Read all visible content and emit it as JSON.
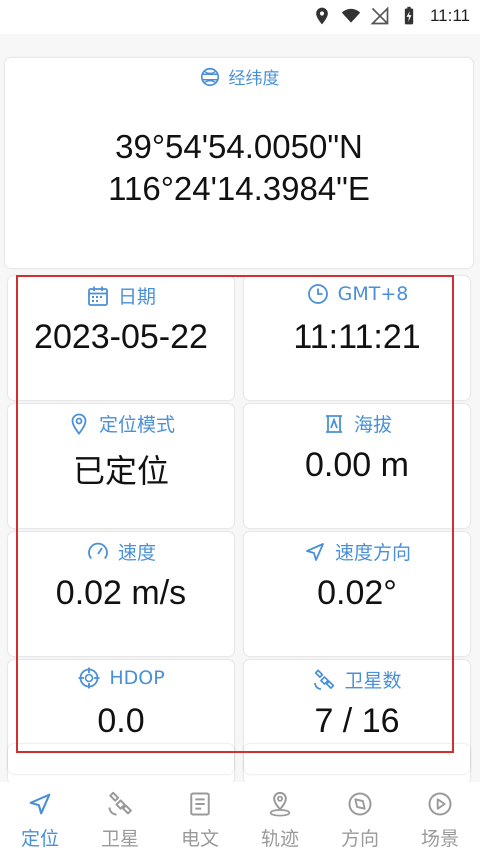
{
  "status_bar": {
    "time": "11:11",
    "icons": [
      "location-pin-icon",
      "wifi-icon",
      "no-signal-icon",
      "battery-charging-icon"
    ]
  },
  "coordinates": {
    "title": "经纬度",
    "latitude": "39°54'54.0050\"N",
    "longitude": "116°24'14.3984\"E"
  },
  "grid": {
    "date": {
      "label": "日期",
      "value": "2023-05-22",
      "icon": "calendar-icon"
    },
    "time": {
      "label": "GMT+8",
      "value": "11:11:21",
      "icon": "clock-icon"
    },
    "mode": {
      "label": "定位模式",
      "value": "已定位",
      "icon": "location-pin-icon"
    },
    "altitude": {
      "label": "海拔",
      "value": "0.00 m",
      "icon": "altitude-icon"
    },
    "speed": {
      "label": "速度",
      "value": "0.02 m/s",
      "icon": "speedometer-icon"
    },
    "heading": {
      "label": "速度方向",
      "value": "0.02°",
      "icon": "navigation-arrow-icon"
    },
    "hdop": {
      "label": "HDOP",
      "value": "0.0",
      "icon": "crosshair-icon"
    },
    "satellites": {
      "label": "卫星数",
      "value": "7 / 16",
      "icon": "satellite-icon"
    }
  },
  "nav": {
    "items": [
      {
        "label": "定位",
        "icon": "navigation-arrow-icon",
        "active": true
      },
      {
        "label": "卫星",
        "icon": "satellite-icon",
        "active": false
      },
      {
        "label": "电文",
        "icon": "document-icon",
        "active": false
      },
      {
        "label": "轨迹",
        "icon": "map-pin-icon",
        "active": false
      },
      {
        "label": "方向",
        "icon": "compass-icon",
        "active": false
      },
      {
        "label": "场景",
        "icon": "play-icon",
        "active": false
      }
    ]
  },
  "colors": {
    "accent": "#4a90d9",
    "inactive": "#9a9a9a",
    "highlight_border": "#d0302f"
  }
}
